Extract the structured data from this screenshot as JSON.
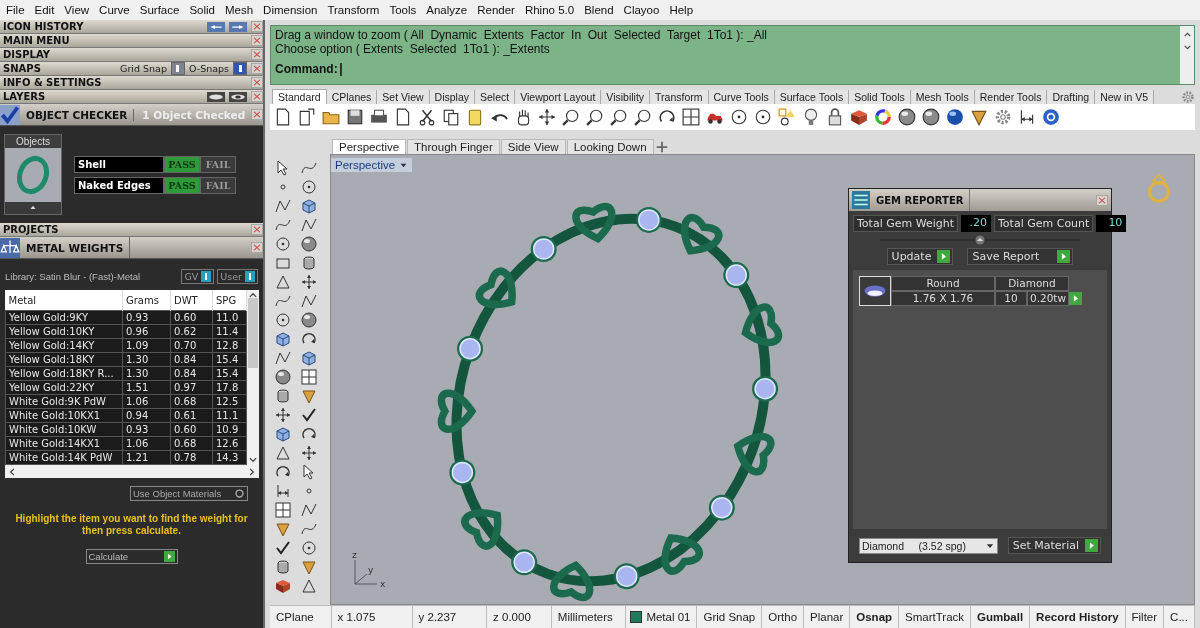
{
  "menu_bar": [
    "File",
    "Edit",
    "View",
    "Curve",
    "Surface",
    "Solid",
    "Mesh",
    "Dimension",
    "Transform",
    "Tools",
    "Analyze",
    "Render",
    "Rhino 5.0",
    "Blend",
    "Clayoo",
    "Help"
  ],
  "left_panel": {
    "sections": [
      {
        "title": "ICON HISTORY",
        "kind": "history"
      },
      {
        "title": "MAIN MENU",
        "kind": "plain"
      },
      {
        "title": "DISPLAY",
        "kind": "plain"
      },
      {
        "title": "SNAPS",
        "kind": "snaps",
        "toggles": [
          {
            "label": "Grid Snap",
            "on": false
          },
          {
            "label": "O-Snaps",
            "on": true
          }
        ]
      },
      {
        "title": "INFO & SETTINGS",
        "kind": "plain"
      },
      {
        "title": "LAYERS",
        "kind": "layers"
      }
    ],
    "object_checker": {
      "title": "OBJECT CHECKER",
      "status": "1  Object Checked",
      "thumbnail_label": "Objects",
      "checks": [
        {
          "name": "Shell",
          "pass_label": "PASS",
          "fail_label": "FAIL",
          "passed": true
        },
        {
          "name": "Naked Edges",
          "pass_label": "PASS",
          "fail_label": "FAIL",
          "passed": true
        }
      ]
    },
    "projects": {
      "title": "PROJECTS"
    },
    "metal_weights": {
      "title": "METAL WEIGHTS",
      "library": "Library: Satin Blur - (Fast)-Metal",
      "toggles": [
        {
          "label": "GV",
          "on": true
        },
        {
          "label": "User",
          "on": true
        }
      ],
      "columns": [
        "Metal",
        "Grams",
        "DWT",
        "SPG"
      ],
      "rows": [
        [
          "Yellow Gold:9KY",
          "0.93",
          "0.60",
          "11.0"
        ],
        [
          "Yellow Gold:10KY",
          "0.96",
          "0.62",
          "11.4"
        ],
        [
          "Yellow Gold:14KY",
          "1.09",
          "0.70",
          "12.8"
        ],
        [
          "Yellow Gold:18KY",
          "1.30",
          "0.84",
          "15.4"
        ],
        [
          "Yellow Gold:18KY R...",
          "1.30",
          "0.84",
          "15.4"
        ],
        [
          "Yellow Gold:22KY",
          "1.51",
          "0.97",
          "17.8"
        ],
        [
          "White Gold:9K PdW",
          "1.06",
          "0.68",
          "12.5"
        ],
        [
          "White Gold:10KX1",
          "0.94",
          "0.61",
          "11.1"
        ],
        [
          "White Gold:10KW",
          "0.93",
          "0.60",
          "10.9"
        ],
        [
          "White Gold:14KX1",
          "1.06",
          "0.68",
          "12.6"
        ],
        [
          "White Gold:14K PdW",
          "1.21",
          "0.78",
          "14.3"
        ]
      ],
      "use_object_materials": "Use Object Materials",
      "hint": "Highlight the item you want to find the weight for then press calculate.",
      "calculate": "Calculate"
    }
  },
  "command": {
    "history": [
      "Drag a window to zoom ( All  Dynamic  Extents  Factor  In  Out  Selected  Target  1To1 ): _All",
      "Choose option ( Extents  Selected  1To1 ): _Extents"
    ],
    "prompt": "Command:"
  },
  "toolbar_tabs": [
    {
      "label": "Standard",
      "selected": true
    },
    {
      "label": "CPlanes",
      "selected": false
    },
    {
      "label": "Set View",
      "selected": false
    },
    {
      "label": "Display",
      "selected": false
    },
    {
      "label": "Select",
      "selected": false
    },
    {
      "label": "Viewport Layout",
      "selected": false
    },
    {
      "label": "Visibility",
      "selected": false
    },
    {
      "label": "Transform",
      "selected": false
    },
    {
      "label": "Curve Tools",
      "selected": false
    },
    {
      "label": "Surface Tools",
      "selected": false
    },
    {
      "label": "Solid Tools",
      "selected": false
    },
    {
      "label": "Mesh Tools",
      "selected": false
    },
    {
      "label": "Render Tools",
      "selected": false
    },
    {
      "label": "Drafting",
      "selected": false
    },
    {
      "label": "New in V5",
      "selected": false
    }
  ],
  "viewport_tabs": [
    {
      "label": "Perspective",
      "selected": true
    },
    {
      "label": "Through Finger",
      "selected": false
    },
    {
      "label": "Side View",
      "selected": false
    },
    {
      "label": "Looking Down",
      "selected": false
    }
  ],
  "viewport": {
    "title": "Perspective",
    "axis_labels": [
      "z",
      "y",
      "x"
    ]
  },
  "gem_reporter": {
    "title": "GEM REPORTER",
    "total_weight_label": "Total Gem Weight",
    "total_weight": ".20",
    "total_count_label": "Total Gem Count",
    "total_count": "10",
    "update": "Update",
    "save_report": "Save Report",
    "gems": [
      {
        "shape": "Round",
        "material": "Diamond",
        "size": "1.76 X 1.76",
        "count": "10",
        "weight": "0.20tw"
      }
    ],
    "material_select": "Diamond     (3.52 spg)",
    "set_material": "Set Material"
  },
  "status_bar": {
    "cplane": "CPlane",
    "x": "x 1.075",
    "y": "y 2.237",
    "z": "z 0.000",
    "units": "Millimeters",
    "layer": {
      "name": "Metal 01",
      "color": "#1e7a5a"
    },
    "toggles": [
      {
        "label": "Grid Snap",
        "on": false
      },
      {
        "label": "Ortho",
        "on": false
      },
      {
        "label": "Planar",
        "on": false
      },
      {
        "label": "Osnap",
        "on": true
      },
      {
        "label": "SmartTrack",
        "on": false
      },
      {
        "label": "Gumball",
        "on": true
      },
      {
        "label": "Record History",
        "on": true
      },
      {
        "label": "Filter",
        "on": false
      },
      {
        "label": "C...",
        "on": false
      }
    ]
  }
}
